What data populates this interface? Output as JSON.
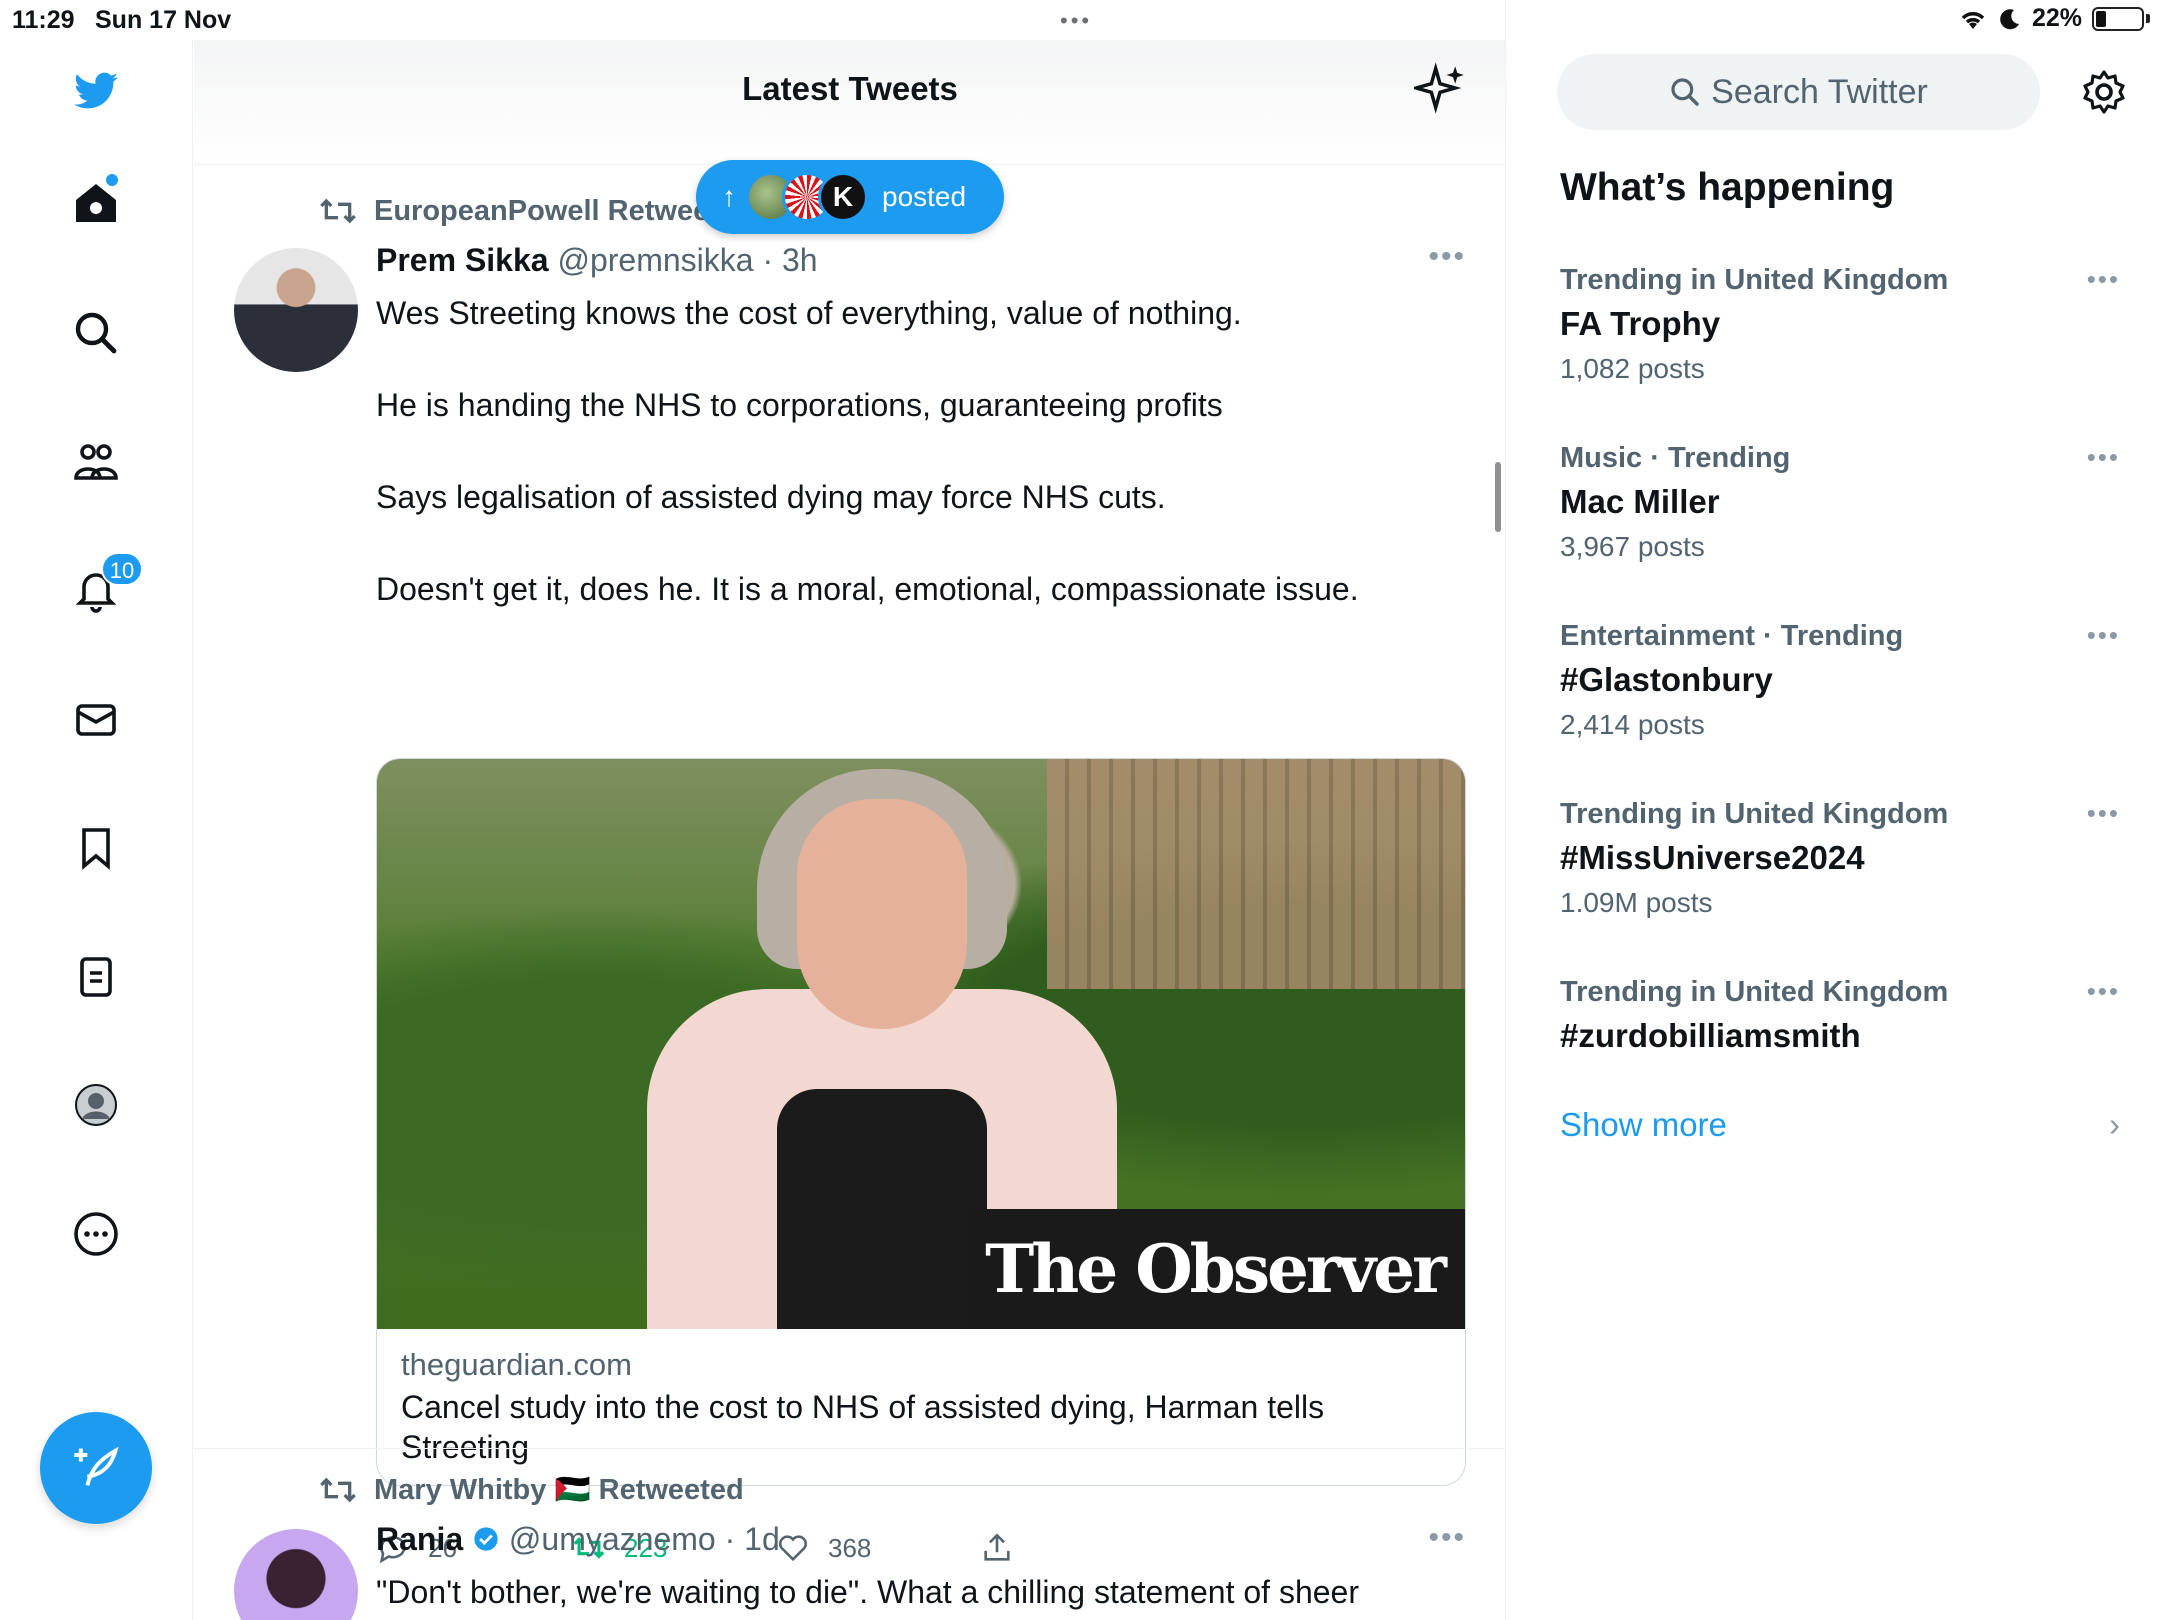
{
  "status_bar": {
    "time": "11:29",
    "date": "Sun 17 Nov",
    "battery": "22%"
  },
  "nav": {
    "notifications_badge": "10"
  },
  "header": {
    "title": "Latest Tweets"
  },
  "posted_pill": {
    "label": "posted",
    "avatar_letter": "K"
  },
  "tweets": [
    {
      "retweeted_by": "EuropeanPowell Retweeted",
      "name": "Prem Sikka",
      "handle": "@premnsikka",
      "time": "· 3h",
      "paragraphs": [
        "Wes Streeting knows the cost of everything, value of nothing.",
        "He is handing the NHS to corporations, guaranteeing profits",
        "Says legalisation of assisted dying may force NHS cuts.",
        "Doesn't get it, does he. It is a moral, emotional, compassionate issue."
      ],
      "card": {
        "overlay": "The Observer",
        "domain": "theguardian.com",
        "title": "Cancel study into the cost to NHS of assisted dying, Harman tells Streeting"
      },
      "replies": "26",
      "retweets": "223",
      "likes": "368"
    },
    {
      "retweeted_by": "Mary Whitby 🇵🇸 Retweeted",
      "name": "Rania",
      "handle": "@umyaznemo",
      "time": "· 1d",
      "text": "\"Don't bother, we're waiting to die\". What a chilling statement of sheer"
    }
  ],
  "sidebar": {
    "search_placeholder": "Search Twitter",
    "heading": "What’s happening",
    "trends": [
      {
        "category": "Trending in United Kingdom",
        "name": "FA Trophy",
        "count": "1,082 posts"
      },
      {
        "category": "Music · Trending",
        "name": "Mac Miller",
        "count": "3,967 posts"
      },
      {
        "category": "Entertainment · Trending",
        "name": "#Glastonbury",
        "count": "2,414 posts"
      },
      {
        "category": "Trending in United Kingdom",
        "name": "#MissUniverse2024",
        "count": "1.09M posts"
      },
      {
        "category": "Trending in United Kingdom",
        "name": "#zurdobilliamsmith",
        "count": ""
      }
    ],
    "show_more": "Show more"
  },
  "colors": {
    "accent": "#1d9bf0",
    "retweet_green": "#00ba7c",
    "secondary_text": "#536471"
  }
}
